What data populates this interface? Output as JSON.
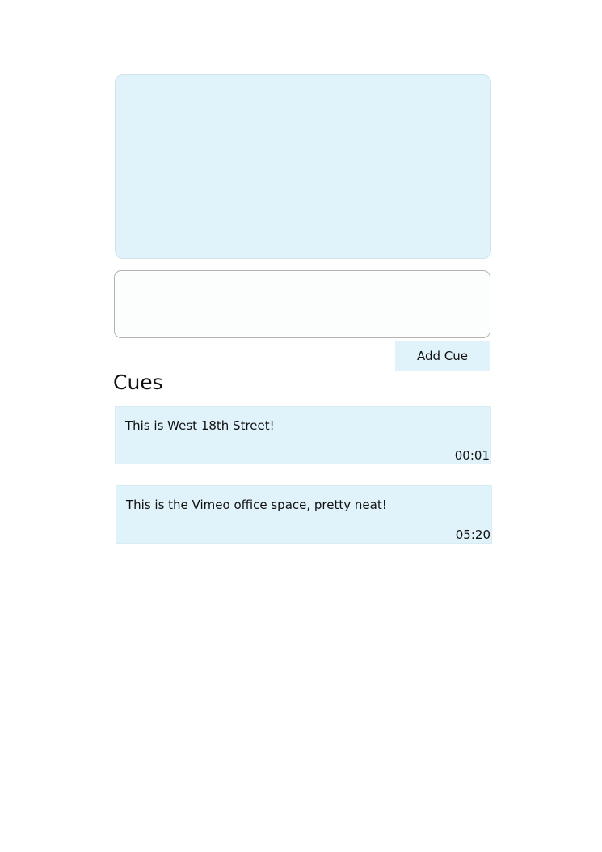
{
  "player": {},
  "cue_input": {
    "value": "",
    "placeholder": ""
  },
  "add_button": {
    "label": "Add Cue"
  },
  "cues": {
    "heading": "Cues",
    "items": [
      {
        "text": "This is West 18th Street!",
        "time": "00:01"
      },
      {
        "text": "This is the Vimeo office space, pretty neat!",
        "time": "05:20"
      }
    ]
  },
  "colors": {
    "panel": "#e0f3fa",
    "input_border": "#b3b3b3"
  }
}
